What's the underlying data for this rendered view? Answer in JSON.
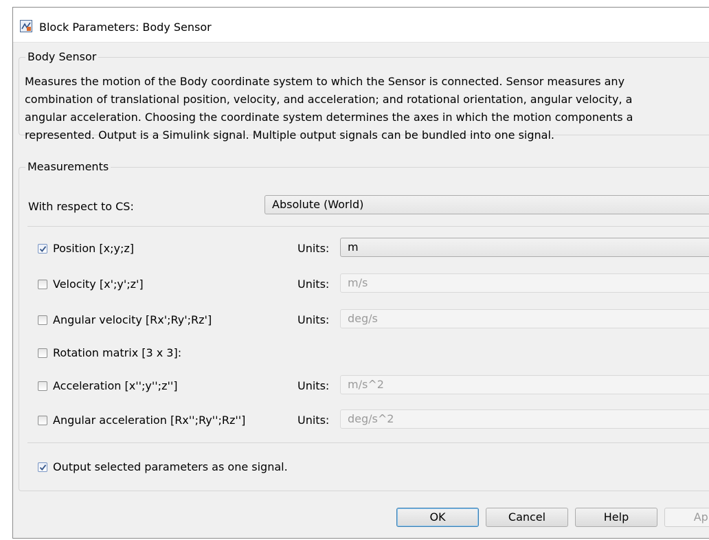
{
  "window": {
    "title": "Block Parameters: Body Sensor"
  },
  "description_group": {
    "label": "Body Sensor",
    "lines": [
      "Measures the motion of the Body coordinate system to which the Sensor is connected. Sensor measures any",
      "combination of translational position, velocity, and acceleration; and rotational orientation, angular velocity, a",
      "angular acceleration. Choosing the coordinate system determines the axes in which the motion components a",
      "represented. Output is a Simulink signal. Multiple output signals can be bundled into one signal."
    ]
  },
  "measurements": {
    "label": "Measurements",
    "cs_label": "With respect to CS:",
    "cs_value": "Absolute (World)",
    "units_label": "Units:",
    "rows": [
      {
        "label": "Position [x;y;z]",
        "checked": true,
        "units": "m"
      },
      {
        "label": "Velocity [x';y';z']",
        "checked": false,
        "units": "m/s"
      },
      {
        "label": "Angular velocity [Rx';Ry';Rz']",
        "checked": false,
        "units": "deg/s"
      },
      {
        "label": "Rotation matrix [3 x 3]:",
        "checked": false,
        "units": null
      },
      {
        "label": "Acceleration [x'';y'';z'']",
        "checked": false,
        "units": "m/s^2"
      },
      {
        "label": "Angular acceleration [Rx'';Ry'';Rz'']",
        "checked": false,
        "units": "deg/s^2"
      }
    ],
    "output_one_signal": {
      "label": "Output selected parameters as one signal.",
      "checked": true
    }
  },
  "buttons": {
    "ok": "OK",
    "cancel": "Cancel",
    "help": "Help",
    "apply": "App"
  },
  "icons": {
    "app": "simulink-block-icon",
    "combo_arrow": "chevron-down-icon",
    "check": "checkmark-icon"
  },
  "colors": {
    "window_bg": "#f0f0f0",
    "check_mark": "#3a5a8c",
    "default_button_border": "#3c7fb1"
  }
}
